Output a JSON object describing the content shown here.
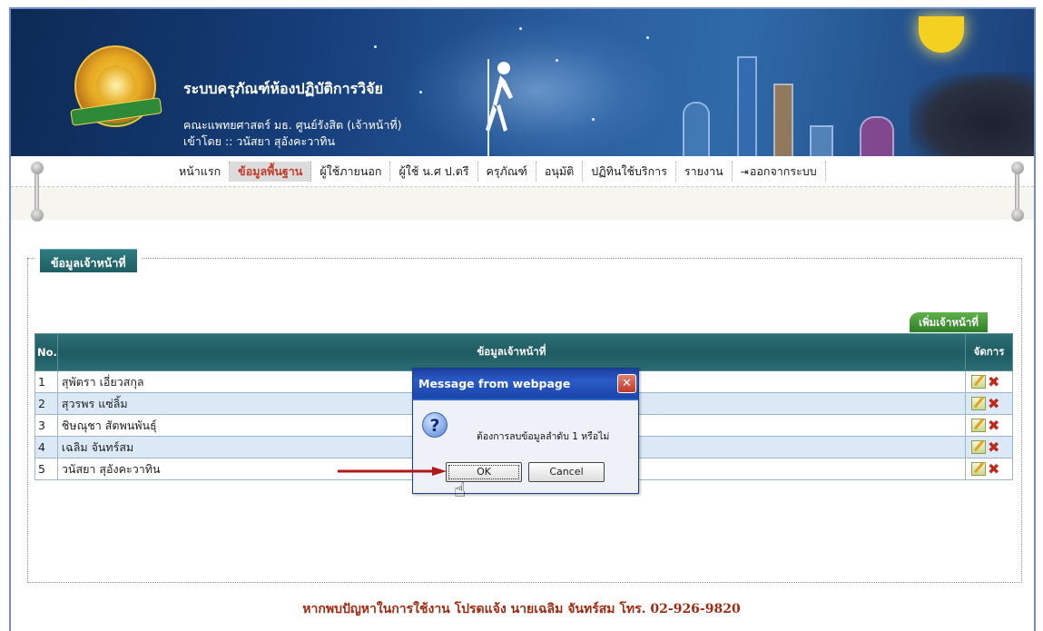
{
  "header": {
    "system_title": "ระบบครุภัณฑ์ห้องปฏิบัติการวิจัย",
    "faculty": "คณะแพทยศาสตร์ มธ. ศูนย์รังสิต (เจ้าหน้าที่)",
    "logged_in": "เข้าโดย :: วนัสยา สุอังคะวาทิน"
  },
  "menu": {
    "items": [
      {
        "label": "หน้าแรก"
      },
      {
        "label": "ข้อมูลพื้นฐาน",
        "active": true
      },
      {
        "label": "ผู้ใช้ภายนอก"
      },
      {
        "label": "ผู้ใช้ น.ศ ป.ตรี"
      },
      {
        "label": "ครุภัณฑ์"
      },
      {
        "label": "อนุมัติ"
      },
      {
        "label": "ปฏิทินใช้บริการ"
      },
      {
        "label": "รายงาน"
      },
      {
        "label": "ออกจากระบบ"
      }
    ]
  },
  "section": {
    "legend": "ข้อมูลเจ้าหน้าที่",
    "add_button": "เพิ่มเจ้าหน้าที่"
  },
  "table": {
    "headers": {
      "no": "No.",
      "info": "ข้อมูลเจ้าหน้าที่",
      "action": "จัดการ"
    },
    "rows": [
      {
        "no": "1",
        "name": "สุพัตรา เอี่ยวสกุล"
      },
      {
        "no": "2",
        "name": "สุวรพร แซ่ลิ้ม"
      },
      {
        "no": "3",
        "name": "ชิษณุชา สัตพนพันธุ์"
      },
      {
        "no": "4",
        "name": "เฉลิม จันทร์สม"
      },
      {
        "no": "5",
        "name": "วนัสยา สุอังคะวาทิน"
      }
    ]
  },
  "dialog": {
    "title": "Message from webpage",
    "message": "ต้องการลบข้อมูลลำดับ 1 หรือไม่",
    "ok": "OK",
    "cancel": "Cancel",
    "close": "✕"
  },
  "footer": {
    "text": "หากพบปัญหาในการใช้งาน โปรดแจ้ง นายเฉลิม จันทร์สม โทร. 02-926-9820"
  },
  "colors": {
    "banner": "#163e7a",
    "table_header": "#1f5b62",
    "row_alt": "#dbe8f6",
    "active_menu": "#c23a2a",
    "footer_text": "#a22a10"
  }
}
